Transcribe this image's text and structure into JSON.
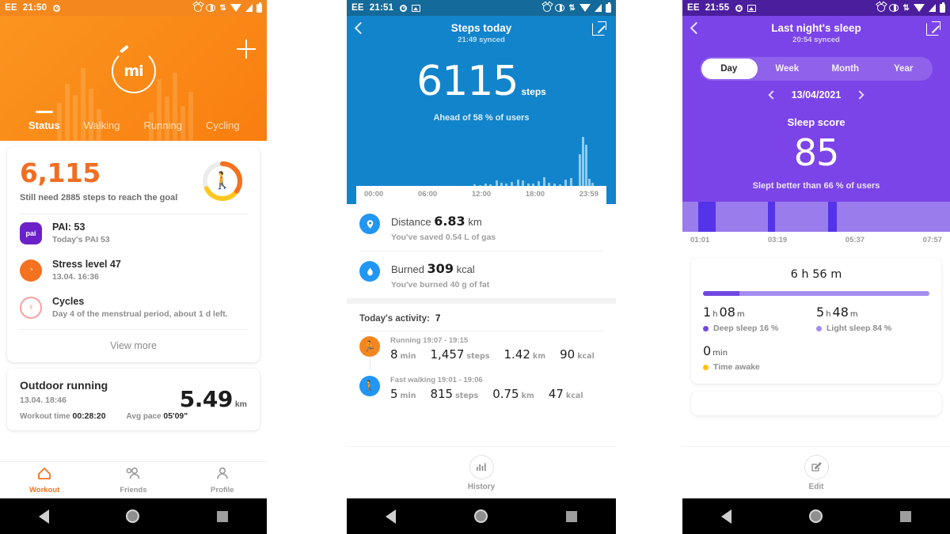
{
  "panels": {
    "steps_status": {
      "statusbar": {
        "carrier": "EE",
        "time": "21:50"
      },
      "hero": {
        "tabs": [
          {
            "label": "Status",
            "active": true
          },
          {
            "label": "Walking",
            "active": false
          },
          {
            "label": "Running",
            "active": false
          },
          {
            "label": "Cycling",
            "active": false
          }
        ],
        "logo_text": "mi",
        "add_button": "+"
      },
      "steps_card": {
        "count": "6,115",
        "goal_text": "Still need 2885 steps to reach the goal",
        "ring_progress_pct": 68,
        "accent": "#f06e23"
      },
      "metrics": [
        {
          "icon": "pai-icon",
          "icon_text": "pai",
          "title": "PAI: 53",
          "subtitle": "Today's PAI 53",
          "color": "#6b21c8"
        },
        {
          "icon": "stress-gauge-icon",
          "icon_text": "",
          "title": "Stress level 47",
          "subtitle": "13.04. 16:36",
          "color": "#f4711f"
        },
        {
          "icon": "cycles-icon",
          "icon_text": "",
          "title": "Cycles",
          "subtitle": "Day 4 of the menstrual period, about 1 d left.",
          "color": "#f06a6a"
        }
      ],
      "view_more": "View more",
      "workout_card": {
        "title": "Outdoor running",
        "datetime": "13.04. 18:46",
        "distance": "5.49",
        "distance_unit": "km",
        "workout_time_label": "Workout time",
        "workout_time_value": "00:28:20",
        "avg_pace_label": "Avg pace",
        "avg_pace_value": "05'09\""
      },
      "bottom_nav": [
        {
          "label": "Workout",
          "icon": "home-icon",
          "active": true
        },
        {
          "label": "Friends",
          "icon": "friends-icon",
          "active": false
        },
        {
          "label": "Profile",
          "icon": "profile-icon",
          "active": false
        }
      ]
    },
    "steps_today": {
      "statusbar": {
        "carrier": "EE",
        "time": "21:51"
      },
      "header": {
        "title": "Steps today",
        "subtitle": "21:49 synced",
        "back": "back-icon",
        "share": "share-icon"
      },
      "hero": {
        "steps": "6115",
        "steps_unit": "steps",
        "ahead_text": "Ahead of 58 % of users"
      },
      "stats": [
        {
          "icon": "location-pin-icon",
          "label": "Distance",
          "value": "6.83",
          "unit": "km",
          "sub": "You've saved 0.54 L  of gas"
        },
        {
          "icon": "flame-icon",
          "label": "Burned",
          "value": "309",
          "unit": "kcal",
          "sub": "You've burned 40 g  of fat"
        }
      ],
      "activity": {
        "header_label": "Today's activity:",
        "header_count": "7",
        "items": [
          {
            "icon": "running-icon",
            "color": "#f4861f",
            "name": "Running",
            "range": "19:07 - 19:15",
            "duration": "8",
            "duration_unit": "min",
            "steps": "1,457",
            "steps_unit": "steps",
            "distance": "1.42",
            "distance_unit": "km",
            "kcal": "90",
            "kcal_unit": "kcal"
          },
          {
            "icon": "walking-icon",
            "color": "#2196f3",
            "name": "Fast walking",
            "range": "19:01 - 19:06",
            "duration": "5",
            "duration_unit": "min",
            "steps": "815",
            "steps_unit": "steps",
            "distance": "0.75",
            "distance_unit": "km",
            "kcal": "47",
            "kcal_unit": "kcal"
          }
        ]
      },
      "footer": {
        "label": "History",
        "icon": "bar-chart-icon"
      }
    },
    "sleep": {
      "statusbar": {
        "carrier": "EE",
        "time": "21:55"
      },
      "header": {
        "title": "Last night's sleep",
        "subtitle": "20:54 synced",
        "back": "back-icon",
        "share": "share-icon"
      },
      "period_tabs": [
        {
          "label": "Day",
          "active": true
        },
        {
          "label": "Week",
          "active": false
        },
        {
          "label": "Month",
          "active": false
        },
        {
          "label": "Year",
          "active": false
        }
      ],
      "date": "13/04/2021",
      "score": {
        "label": "Sleep score",
        "value": "85",
        "sub": "Slept better than 66 % of users"
      },
      "detail": {
        "total": "6 h 56 m",
        "deep": {
          "value_h": "1",
          "h": "h",
          "value_m": "08",
          "m": "m",
          "label": "Deep sleep 16 %",
          "color": "#7048e0",
          "pct": 16
        },
        "light": {
          "value_h": "5",
          "h": "h",
          "value_m": "48",
          "m": "m",
          "label": "Light sleep 84 %",
          "color": "#a38cf0",
          "pct": 84
        },
        "awake": {
          "value": "0",
          "unit": "min",
          "label": "Time awake",
          "color": "#ffc107"
        }
      },
      "footer": {
        "label": "Edit",
        "icon": "edit-icon"
      }
    }
  },
  "chart_data": [
    {
      "id": "steps-today-hourly",
      "type": "bar",
      "title": "Steps today",
      "xlabel": "",
      "ylabel": "steps",
      "tick_labels": [
        "00:00",
        "06:00",
        "12:00",
        "18:00",
        "23:59"
      ],
      "total_steps": 6115,
      "series_color": "#8ecbf2",
      "background_color": "#1284cc",
      "x": [
        "00:00",
        "00:30",
        "01:00",
        "01:30",
        "02:00",
        "02:30",
        "03:00",
        "03:30",
        "04:00",
        "04:30",
        "05:00",
        "05:30",
        "06:00",
        "06:30",
        "07:00",
        "07:30",
        "08:00",
        "08:30",
        "09:00",
        "09:30",
        "10:00",
        "10:30",
        "11:00",
        "11:30",
        "12:00",
        "12:30",
        "13:00",
        "13:30",
        "14:00",
        "14:30",
        "15:00",
        "15:30",
        "16:00",
        "16:30",
        "17:00",
        "17:30",
        "18:00",
        "18:30",
        "19:00",
        "19:30",
        "20:00",
        "20:30",
        "21:00",
        "21:30",
        "22:00",
        "22:30",
        "23:00",
        "23:30"
      ],
      "values": [
        0,
        0,
        0,
        0,
        0,
        0,
        0,
        0,
        0,
        0,
        0,
        0,
        0,
        0,
        0,
        0,
        0,
        0,
        0,
        0,
        2,
        1,
        3,
        2,
        9,
        5,
        3,
        6,
        11,
        9,
        4,
        3,
        7,
        16,
        5,
        3,
        2,
        10,
        14,
        60,
        95,
        78,
        12,
        6,
        0,
        0,
        0,
        0
      ],
      "ylim": [
        0,
        100
      ]
    },
    {
      "id": "sleep-stages",
      "type": "bar",
      "title": "Last night's sleep stages",
      "tick_labels": [
        "01:01",
        "03:19",
        "05:37",
        "07:57"
      ],
      "legend": [
        "Deep sleep",
        "Light sleep"
      ],
      "colors": {
        "deep": "#5533e8",
        "light": "#9a7ced"
      },
      "segments": [
        {
          "stage": "light",
          "start_pct": 0,
          "width_pct": 6
        },
        {
          "stage": "deep",
          "start_pct": 6,
          "width_pct": 6.5
        },
        {
          "stage": "light",
          "start_pct": 12.5,
          "width_pct": 19.5
        },
        {
          "stage": "deep",
          "start_pct": 32,
          "width_pct": 2.5
        },
        {
          "stage": "light",
          "start_pct": 34.5,
          "width_pct": 20
        },
        {
          "stage": "deep",
          "start_pct": 54.5,
          "width_pct": 3.2
        },
        {
          "stage": "light",
          "start_pct": 57.7,
          "width_pct": 42.3
        }
      ],
      "total_minutes": 416,
      "deep_minutes": 68,
      "light_minutes": 348,
      "awake_minutes": 0
    }
  ]
}
